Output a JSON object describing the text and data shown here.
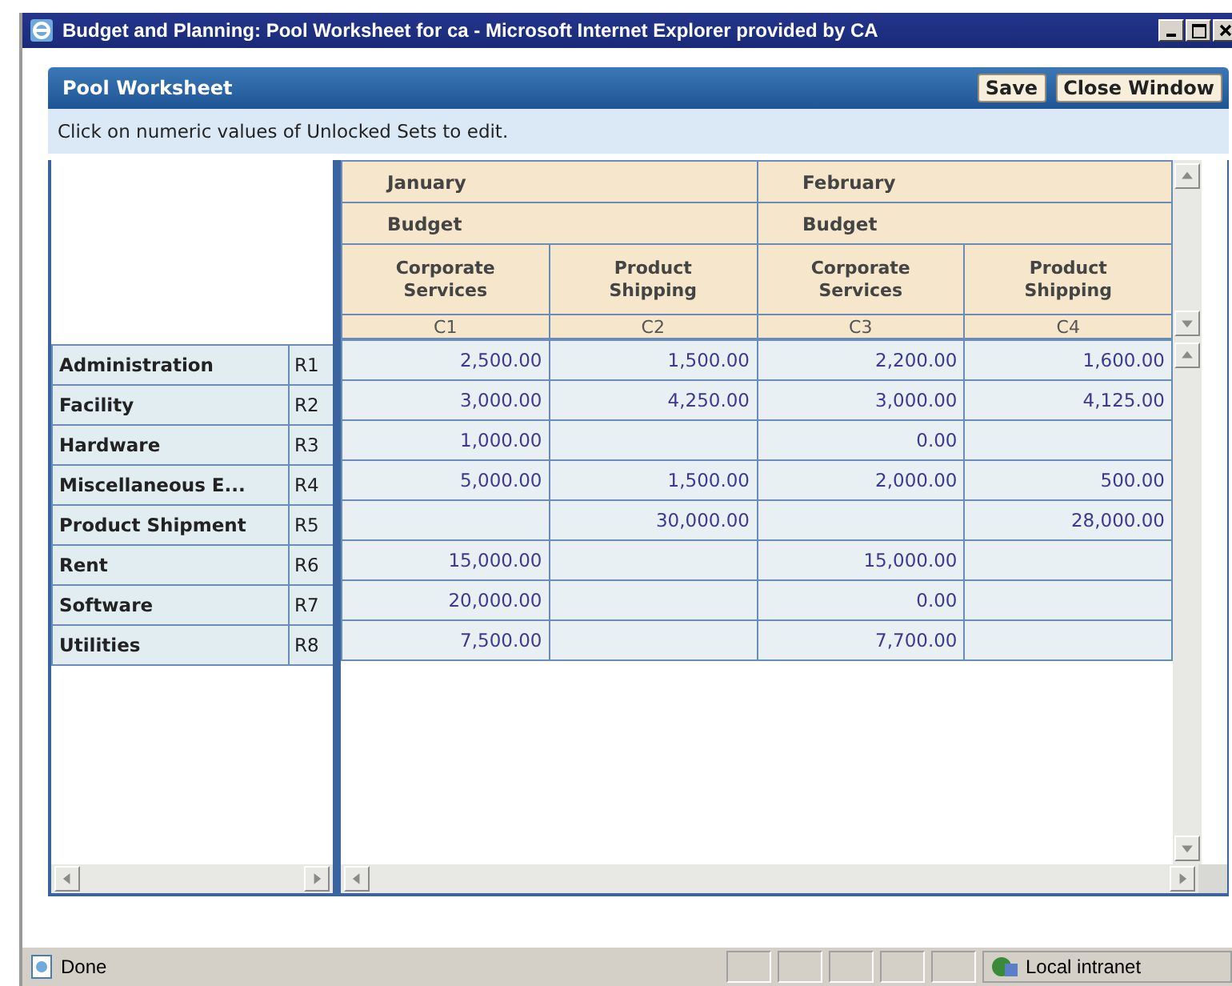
{
  "window": {
    "title": "Budget and Planning: Pool Worksheet for ca - Microsoft Internet Explorer provided by CA"
  },
  "panel": {
    "title": "Pool Worksheet",
    "buttons": [
      "Save",
      "Close Window"
    ],
    "instruction": "Click on numeric values of Unlocked Sets to edit."
  },
  "grid": {
    "months": [
      {
        "label": "January",
        "scenario": "Budget",
        "columns": [
          {
            "label": "Corporate Services",
            "code": "C1"
          },
          {
            "label": "Product Shipping",
            "code": "C2"
          }
        ]
      },
      {
        "label": "February",
        "scenario": "Budget",
        "columns": [
          {
            "label": "Corporate Services",
            "code": "C3"
          },
          {
            "label": "Product Shipping",
            "code": "C4"
          }
        ]
      }
    ],
    "rows": [
      {
        "label": "Administration",
        "code": "R1",
        "column_1": "2,500.00",
        "column_2": "1,500.00",
        "column_3": "2,200.00",
        "column_4": "1,600.00"
      },
      {
        "label": "Facility",
        "code": "R2",
        "column_1": "3,000.00",
        "column_2": "4,250.00",
        "column_3": "3,000.00",
        "column_4": "4,125.00"
      },
      {
        "label": "Hardware",
        "code": "R3",
        "column_1": "1,000.00",
        "column_3": "0.00"
      },
      {
        "label": "Miscellaneous E...",
        "code": "R4",
        "column_1": "5,000.00",
        "column_2": "1,500.00",
        "column_3": "2,000.00",
        "column_4": "500.00"
      },
      {
        "label": "Product Shipment",
        "code": "R5",
        "column_2": "30,000.00",
        "column_4": "28,000.00"
      },
      {
        "label": "Rent",
        "code": "R6",
        "column_1": "15,000.00",
        "column_3": "15,000.00"
      },
      {
        "label": "Software",
        "code": "R7",
        "column_1": "20,000.00",
        "column_3": "0.00"
      },
      {
        "label": "Utilities",
        "code": "R8",
        "column_1": "7,500.00",
        "column_3": "7,700.00"
      }
    ]
  },
  "status_bar": {
    "text": "Done",
    "zone": "Local intranet"
  }
}
